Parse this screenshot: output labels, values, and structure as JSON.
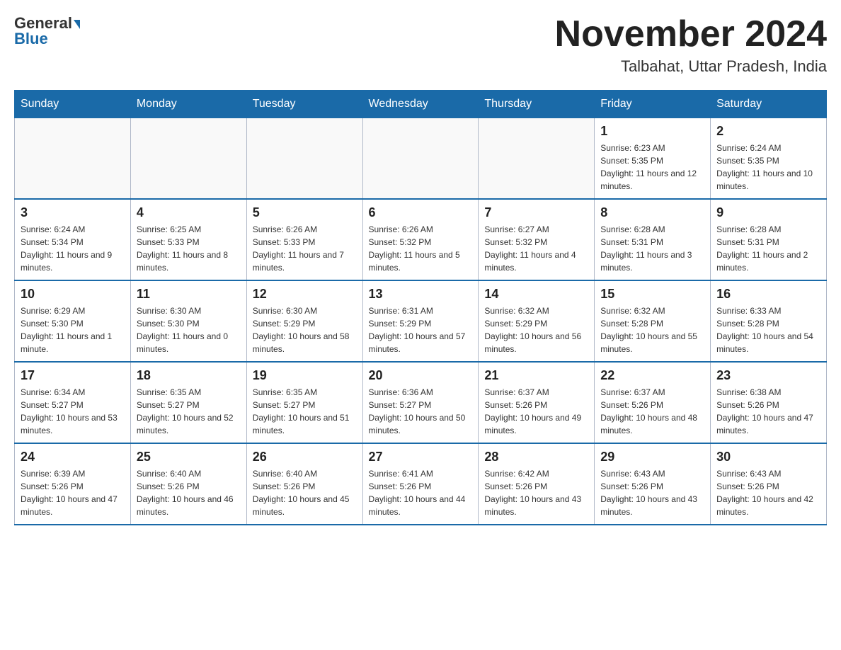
{
  "header": {
    "logo_general": "General",
    "logo_blue": "Blue",
    "month_title": "November 2024",
    "location": "Talbahat, Uttar Pradesh, India"
  },
  "days_of_week": [
    "Sunday",
    "Monday",
    "Tuesday",
    "Wednesday",
    "Thursday",
    "Friday",
    "Saturday"
  ],
  "weeks": [
    {
      "days": [
        {
          "number": "",
          "sunrise": "",
          "sunset": "",
          "daylight": ""
        },
        {
          "number": "",
          "sunrise": "",
          "sunset": "",
          "daylight": ""
        },
        {
          "number": "",
          "sunrise": "",
          "sunset": "",
          "daylight": ""
        },
        {
          "number": "",
          "sunrise": "",
          "sunset": "",
          "daylight": ""
        },
        {
          "number": "",
          "sunrise": "",
          "sunset": "",
          "daylight": ""
        },
        {
          "number": "1",
          "sunrise": "Sunrise: 6:23 AM",
          "sunset": "Sunset: 5:35 PM",
          "daylight": "Daylight: 11 hours and 12 minutes."
        },
        {
          "number": "2",
          "sunrise": "Sunrise: 6:24 AM",
          "sunset": "Sunset: 5:35 PM",
          "daylight": "Daylight: 11 hours and 10 minutes."
        }
      ]
    },
    {
      "days": [
        {
          "number": "3",
          "sunrise": "Sunrise: 6:24 AM",
          "sunset": "Sunset: 5:34 PM",
          "daylight": "Daylight: 11 hours and 9 minutes."
        },
        {
          "number": "4",
          "sunrise": "Sunrise: 6:25 AM",
          "sunset": "Sunset: 5:33 PM",
          "daylight": "Daylight: 11 hours and 8 minutes."
        },
        {
          "number": "5",
          "sunrise": "Sunrise: 6:26 AM",
          "sunset": "Sunset: 5:33 PM",
          "daylight": "Daylight: 11 hours and 7 minutes."
        },
        {
          "number": "6",
          "sunrise": "Sunrise: 6:26 AM",
          "sunset": "Sunset: 5:32 PM",
          "daylight": "Daylight: 11 hours and 5 minutes."
        },
        {
          "number": "7",
          "sunrise": "Sunrise: 6:27 AM",
          "sunset": "Sunset: 5:32 PM",
          "daylight": "Daylight: 11 hours and 4 minutes."
        },
        {
          "number": "8",
          "sunrise": "Sunrise: 6:28 AM",
          "sunset": "Sunset: 5:31 PM",
          "daylight": "Daylight: 11 hours and 3 minutes."
        },
        {
          "number": "9",
          "sunrise": "Sunrise: 6:28 AM",
          "sunset": "Sunset: 5:31 PM",
          "daylight": "Daylight: 11 hours and 2 minutes."
        }
      ]
    },
    {
      "days": [
        {
          "number": "10",
          "sunrise": "Sunrise: 6:29 AM",
          "sunset": "Sunset: 5:30 PM",
          "daylight": "Daylight: 11 hours and 1 minute."
        },
        {
          "number": "11",
          "sunrise": "Sunrise: 6:30 AM",
          "sunset": "Sunset: 5:30 PM",
          "daylight": "Daylight: 11 hours and 0 minutes."
        },
        {
          "number": "12",
          "sunrise": "Sunrise: 6:30 AM",
          "sunset": "Sunset: 5:29 PM",
          "daylight": "Daylight: 10 hours and 58 minutes."
        },
        {
          "number": "13",
          "sunrise": "Sunrise: 6:31 AM",
          "sunset": "Sunset: 5:29 PM",
          "daylight": "Daylight: 10 hours and 57 minutes."
        },
        {
          "number": "14",
          "sunrise": "Sunrise: 6:32 AM",
          "sunset": "Sunset: 5:29 PM",
          "daylight": "Daylight: 10 hours and 56 minutes."
        },
        {
          "number": "15",
          "sunrise": "Sunrise: 6:32 AM",
          "sunset": "Sunset: 5:28 PM",
          "daylight": "Daylight: 10 hours and 55 minutes."
        },
        {
          "number": "16",
          "sunrise": "Sunrise: 6:33 AM",
          "sunset": "Sunset: 5:28 PM",
          "daylight": "Daylight: 10 hours and 54 minutes."
        }
      ]
    },
    {
      "days": [
        {
          "number": "17",
          "sunrise": "Sunrise: 6:34 AM",
          "sunset": "Sunset: 5:27 PM",
          "daylight": "Daylight: 10 hours and 53 minutes."
        },
        {
          "number": "18",
          "sunrise": "Sunrise: 6:35 AM",
          "sunset": "Sunset: 5:27 PM",
          "daylight": "Daylight: 10 hours and 52 minutes."
        },
        {
          "number": "19",
          "sunrise": "Sunrise: 6:35 AM",
          "sunset": "Sunset: 5:27 PM",
          "daylight": "Daylight: 10 hours and 51 minutes."
        },
        {
          "number": "20",
          "sunrise": "Sunrise: 6:36 AM",
          "sunset": "Sunset: 5:27 PM",
          "daylight": "Daylight: 10 hours and 50 minutes."
        },
        {
          "number": "21",
          "sunrise": "Sunrise: 6:37 AM",
          "sunset": "Sunset: 5:26 PM",
          "daylight": "Daylight: 10 hours and 49 minutes."
        },
        {
          "number": "22",
          "sunrise": "Sunrise: 6:37 AM",
          "sunset": "Sunset: 5:26 PM",
          "daylight": "Daylight: 10 hours and 48 minutes."
        },
        {
          "number": "23",
          "sunrise": "Sunrise: 6:38 AM",
          "sunset": "Sunset: 5:26 PM",
          "daylight": "Daylight: 10 hours and 47 minutes."
        }
      ]
    },
    {
      "days": [
        {
          "number": "24",
          "sunrise": "Sunrise: 6:39 AM",
          "sunset": "Sunset: 5:26 PM",
          "daylight": "Daylight: 10 hours and 47 minutes."
        },
        {
          "number": "25",
          "sunrise": "Sunrise: 6:40 AM",
          "sunset": "Sunset: 5:26 PM",
          "daylight": "Daylight: 10 hours and 46 minutes."
        },
        {
          "number": "26",
          "sunrise": "Sunrise: 6:40 AM",
          "sunset": "Sunset: 5:26 PM",
          "daylight": "Daylight: 10 hours and 45 minutes."
        },
        {
          "number": "27",
          "sunrise": "Sunrise: 6:41 AM",
          "sunset": "Sunset: 5:26 PM",
          "daylight": "Daylight: 10 hours and 44 minutes."
        },
        {
          "number": "28",
          "sunrise": "Sunrise: 6:42 AM",
          "sunset": "Sunset: 5:26 PM",
          "daylight": "Daylight: 10 hours and 43 minutes."
        },
        {
          "number": "29",
          "sunrise": "Sunrise: 6:43 AM",
          "sunset": "Sunset: 5:26 PM",
          "daylight": "Daylight: 10 hours and 43 minutes."
        },
        {
          "number": "30",
          "sunrise": "Sunrise: 6:43 AM",
          "sunset": "Sunset: 5:26 PM",
          "daylight": "Daylight: 10 hours and 42 minutes."
        }
      ]
    }
  ]
}
